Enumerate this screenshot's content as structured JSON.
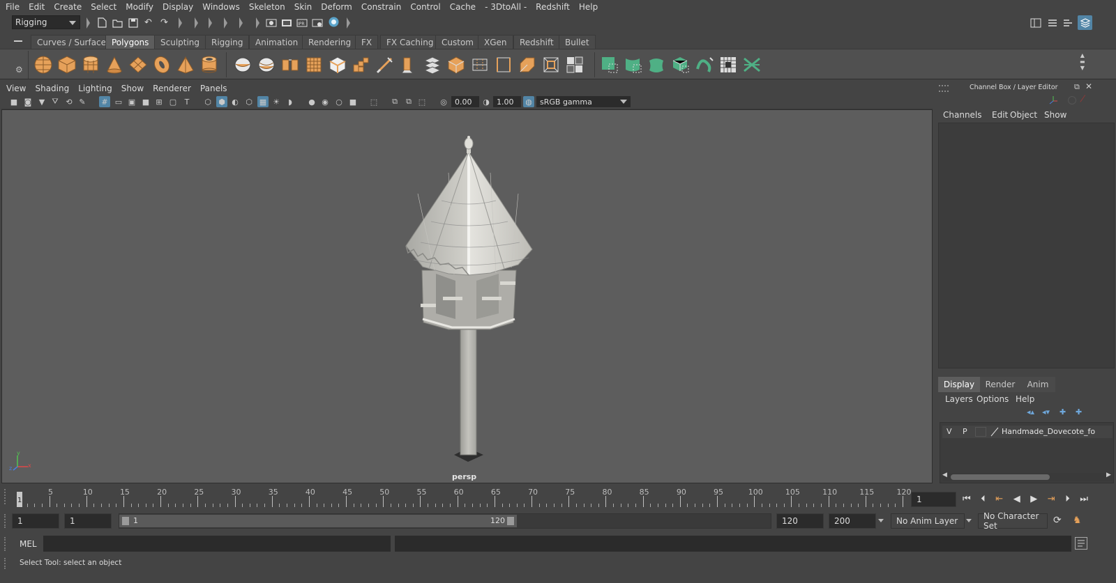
{
  "menubar": {
    "items": [
      "File",
      "Edit",
      "Create",
      "Select",
      "Modify",
      "Display",
      "Windows",
      "Skeleton",
      "Skin",
      "Deform",
      "Constrain",
      "Control",
      "Cache",
      "- 3DtoAll -",
      "Redshift",
      "Help"
    ]
  },
  "statusline": {
    "menuset": "Rigging"
  },
  "shelf": {
    "tabs": [
      "Curves / Surfaces",
      "Polygons",
      "Sculpting",
      "Rigging",
      "Animation",
      "Rendering",
      "FX",
      "FX Caching",
      "Custom",
      "XGen",
      "Redshift",
      "Bullet"
    ],
    "active_tab": "Polygons",
    "icons": [
      "poly-sphere-icon",
      "poly-cube-icon",
      "poly-cylinder-icon",
      "poly-cone-icon",
      "poly-plane-icon",
      "poly-torus-icon",
      "poly-pyramid-icon",
      "poly-pipe-icon",
      "combine-icon",
      "separate-icon",
      "extract-icon",
      "smooth-icon",
      "bevel-icon",
      "bridge-icon",
      "multi-cut-icon",
      "extrude-icon",
      "merge-icon",
      "append-icon",
      "insert-edge-loop-icon",
      "target-weld-icon",
      "mirror-icon",
      "fill-hole-icon",
      "uv-editor-icon",
      "planar-map-icon",
      "cylindrical-map-icon",
      "spherical-map-icon",
      "automatic-map-icon",
      "unfold-icon",
      "layout-uv-icon",
      "checker-icon",
      "sew-icon"
    ]
  },
  "viewport": {
    "menus": [
      "View",
      "Shading",
      "Lighting",
      "Show",
      "Renderer",
      "Panels"
    ],
    "exposure": "0.00",
    "gamma": "1.00",
    "color_space": "sRGB gamma",
    "camera_label": "persp",
    "axis": {
      "x": "x",
      "y": "y",
      "z": "z"
    }
  },
  "channel_box": {
    "title": "Channel Box / Layer Editor",
    "menus": [
      "Channels",
      "Edit",
      "Object",
      "Show"
    ]
  },
  "layer_editor": {
    "tabs": [
      "Display",
      "Render",
      "Anim"
    ],
    "active_tab": "Display",
    "menus": [
      "Layers",
      "Options",
      "Help"
    ],
    "layers": [
      {
        "v": "V",
        "p": "P",
        "name": "Handmade_Dovecote_fo"
      }
    ]
  },
  "timeslider": {
    "start": 1,
    "end": 120,
    "major_labels": [
      5,
      10,
      15,
      20,
      25,
      30,
      35,
      40,
      45,
      50,
      55,
      60,
      65,
      70,
      75,
      80,
      85,
      90,
      95,
      100,
      105,
      110,
      115,
      120
    ],
    "current_frame_marker": "1",
    "current_frame": "1"
  },
  "rangeslider": {
    "anim_start": "1",
    "playback_start": "1",
    "range_start_label": "1",
    "range_end_label": "120",
    "playback_end": "120",
    "anim_end": "200",
    "anim_layer": "No Anim Layer",
    "character_set": "No Character Set"
  },
  "cmdline": {
    "language": "MEL"
  },
  "helpline": {
    "text": "Select Tool: select an object"
  },
  "colors": {
    "accent_blue": "#5285a6",
    "shelf_orange": "#e6a15a",
    "shelf_green": "#4fb085",
    "viewport_bg": "#5d5d5d"
  }
}
